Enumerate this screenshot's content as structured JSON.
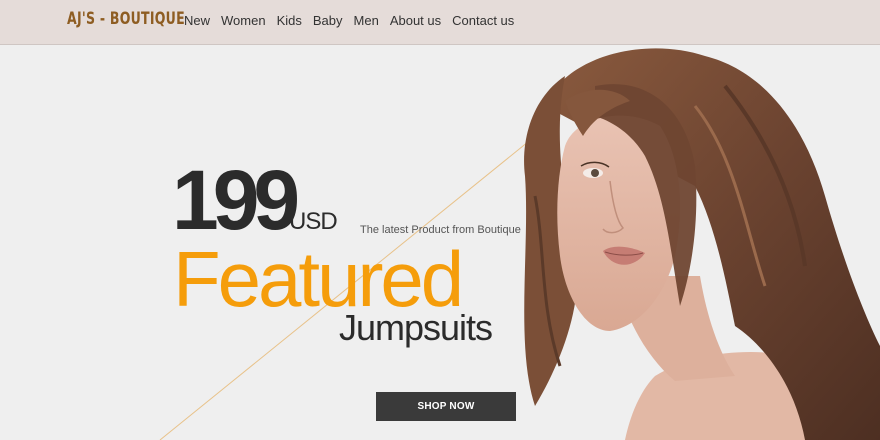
{
  "navbar": {
    "brand": "AJ'S - BOUTIQUE",
    "links": [
      "New",
      "Women",
      "Kids",
      "Baby",
      "Men",
      "About us",
      "Contact us"
    ]
  },
  "hero": {
    "price": "199",
    "currency": "USD",
    "tagline": "The latest Product from Boutique",
    "headline": "Featured",
    "product": "Jumpsuits",
    "cta": "SHOP NOW"
  },
  "colors": {
    "navbar_bg": "#e5dcd9",
    "brand": "#8e5d22",
    "accent_orange": "#f59d0b",
    "dark_text": "#2b2b2b",
    "button_bg": "#3a3a3a",
    "hero_bg": "#efefef"
  },
  "icons": {
    "model_photo": "woman-portrait-image"
  }
}
